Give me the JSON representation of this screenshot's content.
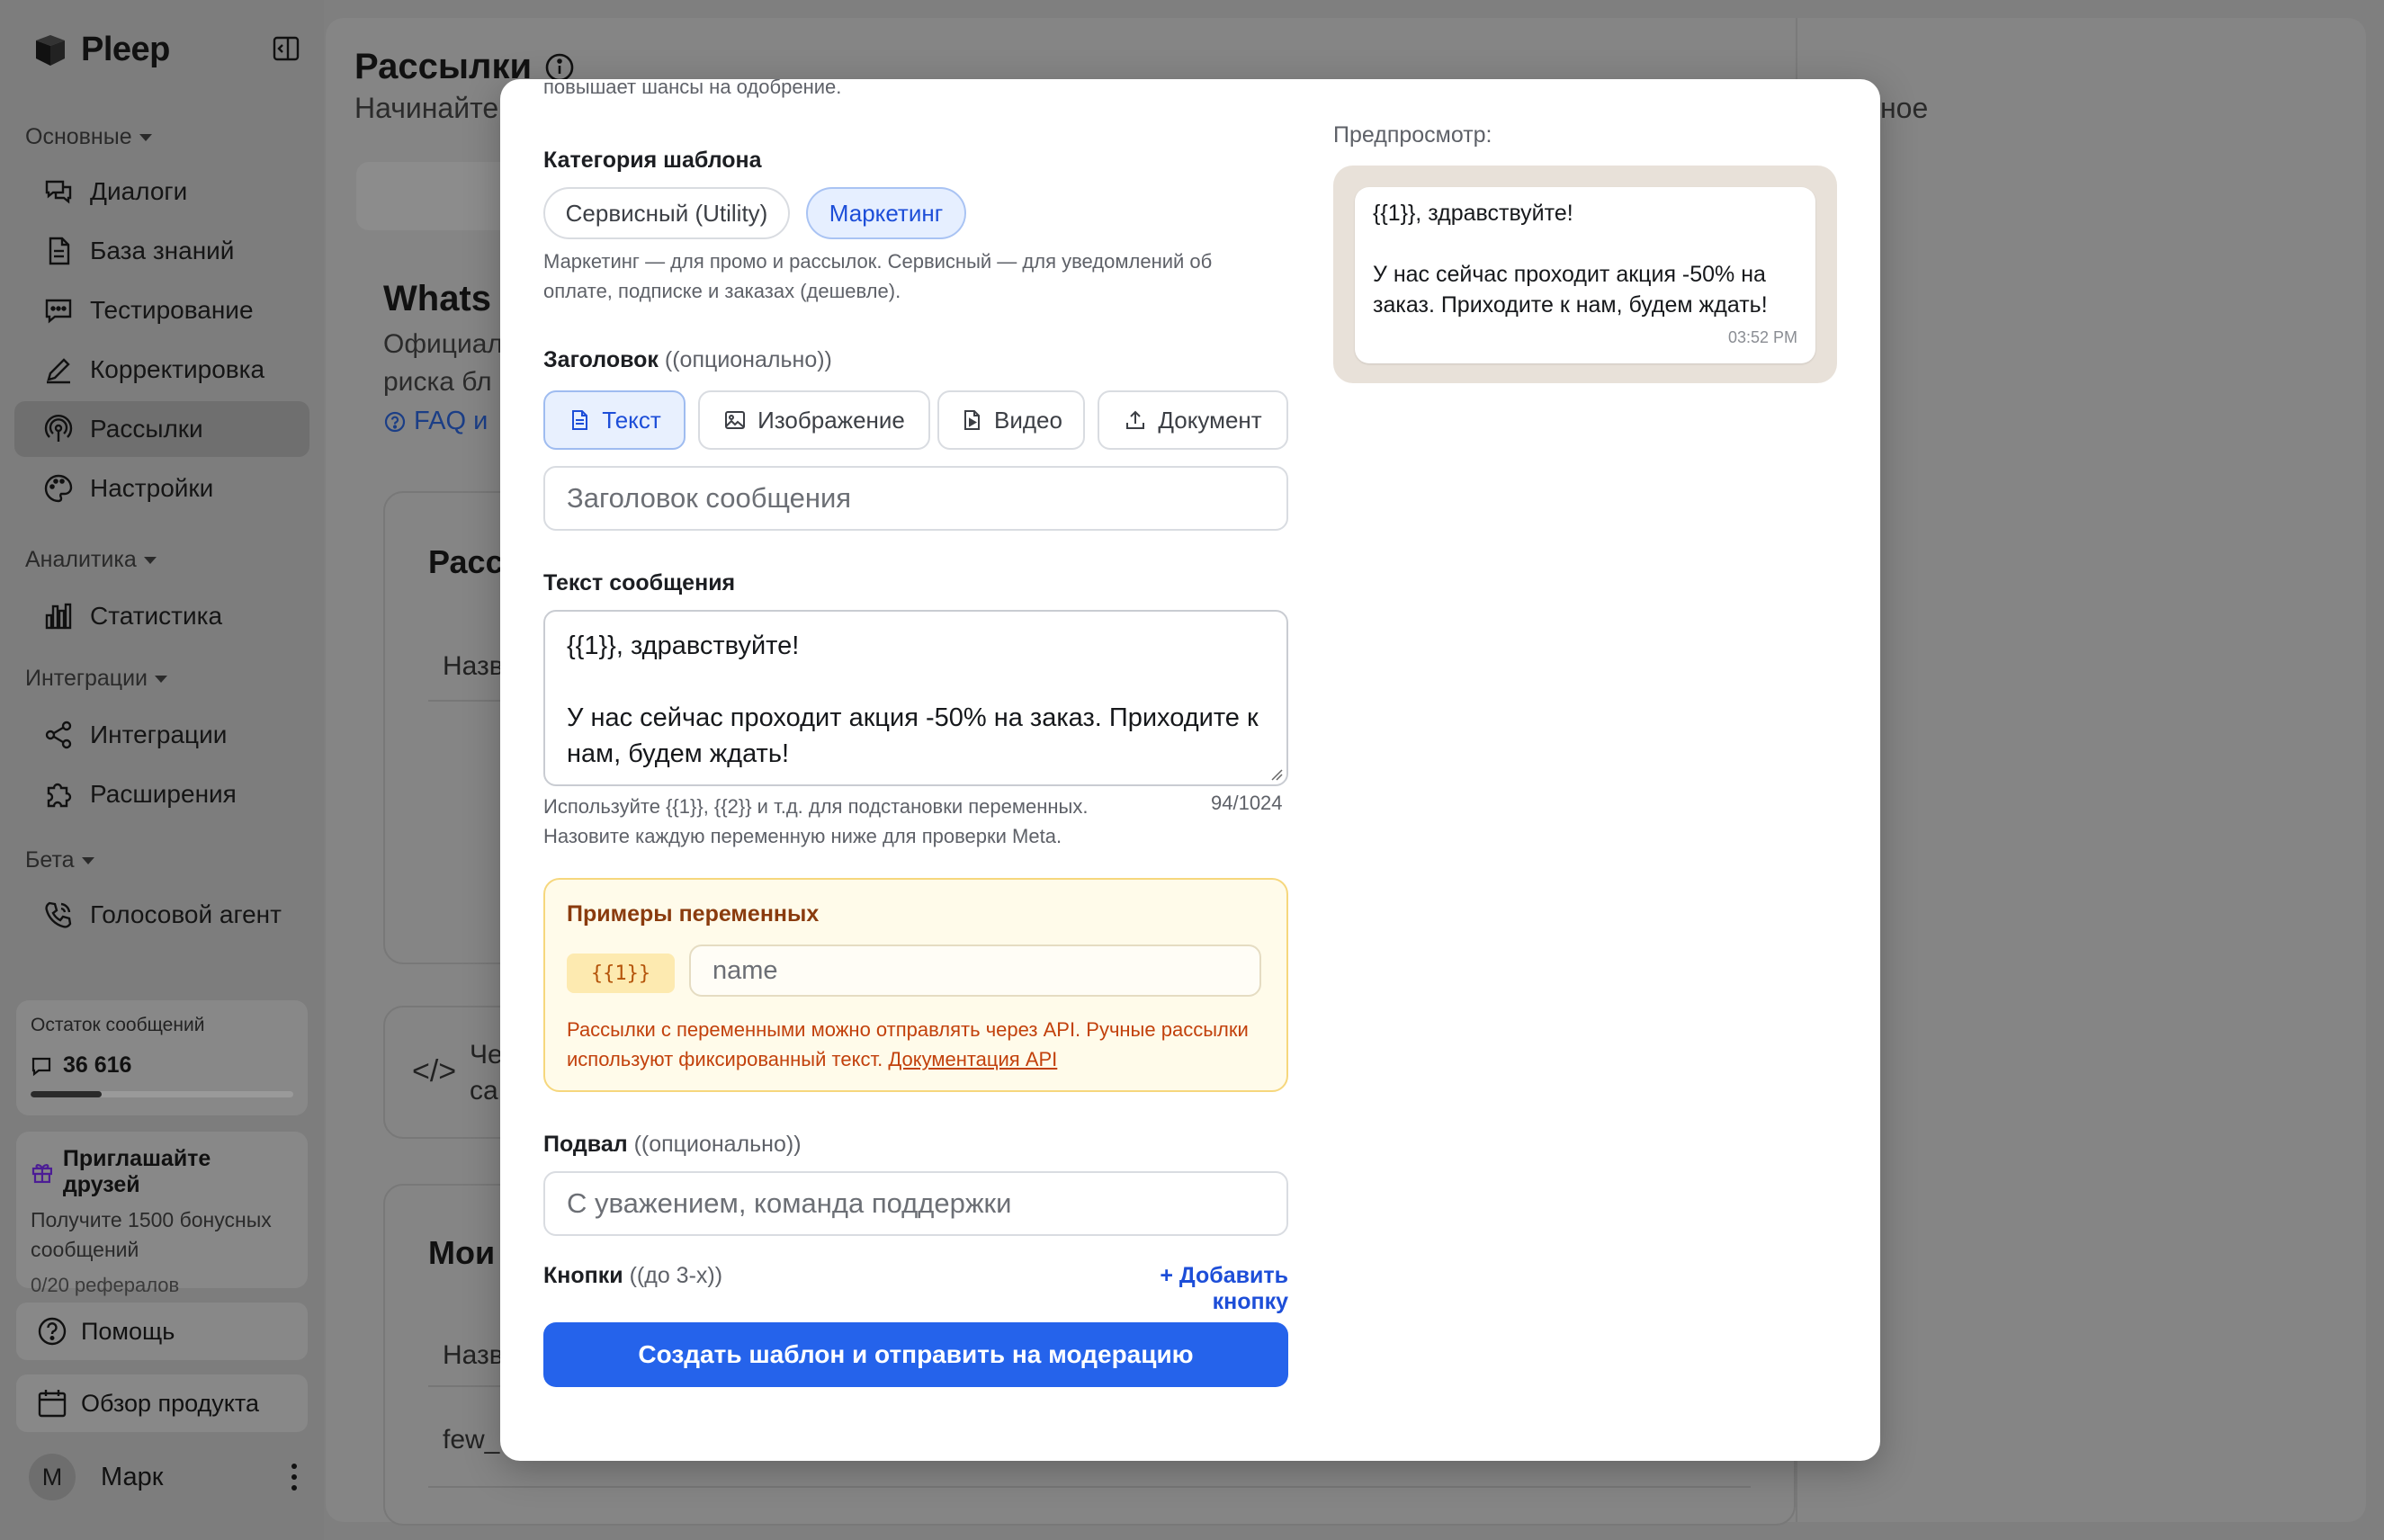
{
  "sidebar": {
    "brand": "Pleep",
    "sections": [
      "Основные",
      "Аналитика",
      "Интеграции",
      "Бета"
    ],
    "items": [
      {
        "label": "Диалоги"
      },
      {
        "label": "База знаний"
      },
      {
        "label": "Тестирование"
      },
      {
        "label": "Корректировка"
      },
      {
        "label": "Рассылки",
        "active": true
      },
      {
        "label": "Настройки"
      },
      {
        "label": "Статистика"
      },
      {
        "label": "Интеграции"
      },
      {
        "label": "Расширения"
      },
      {
        "label": "Голосовой агент"
      }
    ],
    "balance": {
      "title": "Остаток сообщений",
      "value": "36 616",
      "progress": 0.27
    },
    "invite": {
      "title": "Приглашайте друзей",
      "desc": "Получите 1500 бонусных сообщений",
      "referrals": "0/20 рефералов"
    },
    "help": "Помощь",
    "tour": "Обзор продукта",
    "user": {
      "initial": "М",
      "name": "Марк"
    }
  },
  "background": {
    "title": "Рассылки",
    "subtitle": "Начинайте",
    "subtitle_right": "ное",
    "section_title": "Whats",
    "section_text_1": "Официал",
    "section_text_2": "риска бл",
    "faq_link": "FAQ и",
    "panel1_title": "Расс",
    "panel1_col": "Назв",
    "panel2_text_1": "Че",
    "panel2_text_2": "са",
    "panel3_title": "Мои",
    "panel3_col": "Назв",
    "panel3_row": "few_"
  },
  "modal": {
    "cut_text": "повышает шансы на одобрение.",
    "category": {
      "label": "Категория шаблона",
      "options": [
        "Сервисный (Utility)",
        "Маркетинг"
      ],
      "selected": "Маркетинг",
      "help": "Маркетинг — для промо и рассылок. Сервисный — для уведомлений об оплате, подписке и заказах (дешевле)."
    },
    "header": {
      "label": "Заголовок",
      "optional": "((опционально))",
      "types": [
        "Текст",
        "Изображение",
        "Видео",
        "Документ"
      ],
      "selected": "Текст",
      "placeholder": "Заголовок сообщения"
    },
    "body": {
      "label": "Текст сообщения",
      "line1": "{{1}}, здравствуйте!",
      "line2": "У нас сейчас проходит акция -50% на заказ. Приходите к нам, будем ждать!",
      "help": "Используйте {{1}}, {{2}} и т.д. для подстановки переменных. Назовите каждую переменную ниже для проверки Meta.",
      "counter": "94/1024"
    },
    "variables": {
      "title": "Примеры переменных",
      "tag": "{{1}}",
      "placeholder": "name",
      "note": "Рассылки с переменными можно отправлять через API. Ручные рассылки используют фиксированный текст.",
      "link": "Документация API"
    },
    "footer": {
      "label": "Подвал",
      "optional": "((опционально))",
      "placeholder": "С уважением, команда поддержки"
    },
    "buttons": {
      "label": "Кнопки",
      "optional": "((до 3-х))",
      "add": "+ Добавить кнопку"
    },
    "submit": "Создать шаблон и отправить на модерацию",
    "preview": {
      "label": "Предпросмотр:",
      "line1": "{{1}}, здравствуйте!",
      "line2": "У нас сейчас проходит акция -50% на заказ. Приходите к нам, будем ждать!",
      "time": "03:52 PM"
    }
  },
  "colors": {
    "accent": "#2563eb",
    "overlay": "#7f7f7f",
    "warning_bg": "#fffbea",
    "warning_border": "#f6d77d"
  }
}
